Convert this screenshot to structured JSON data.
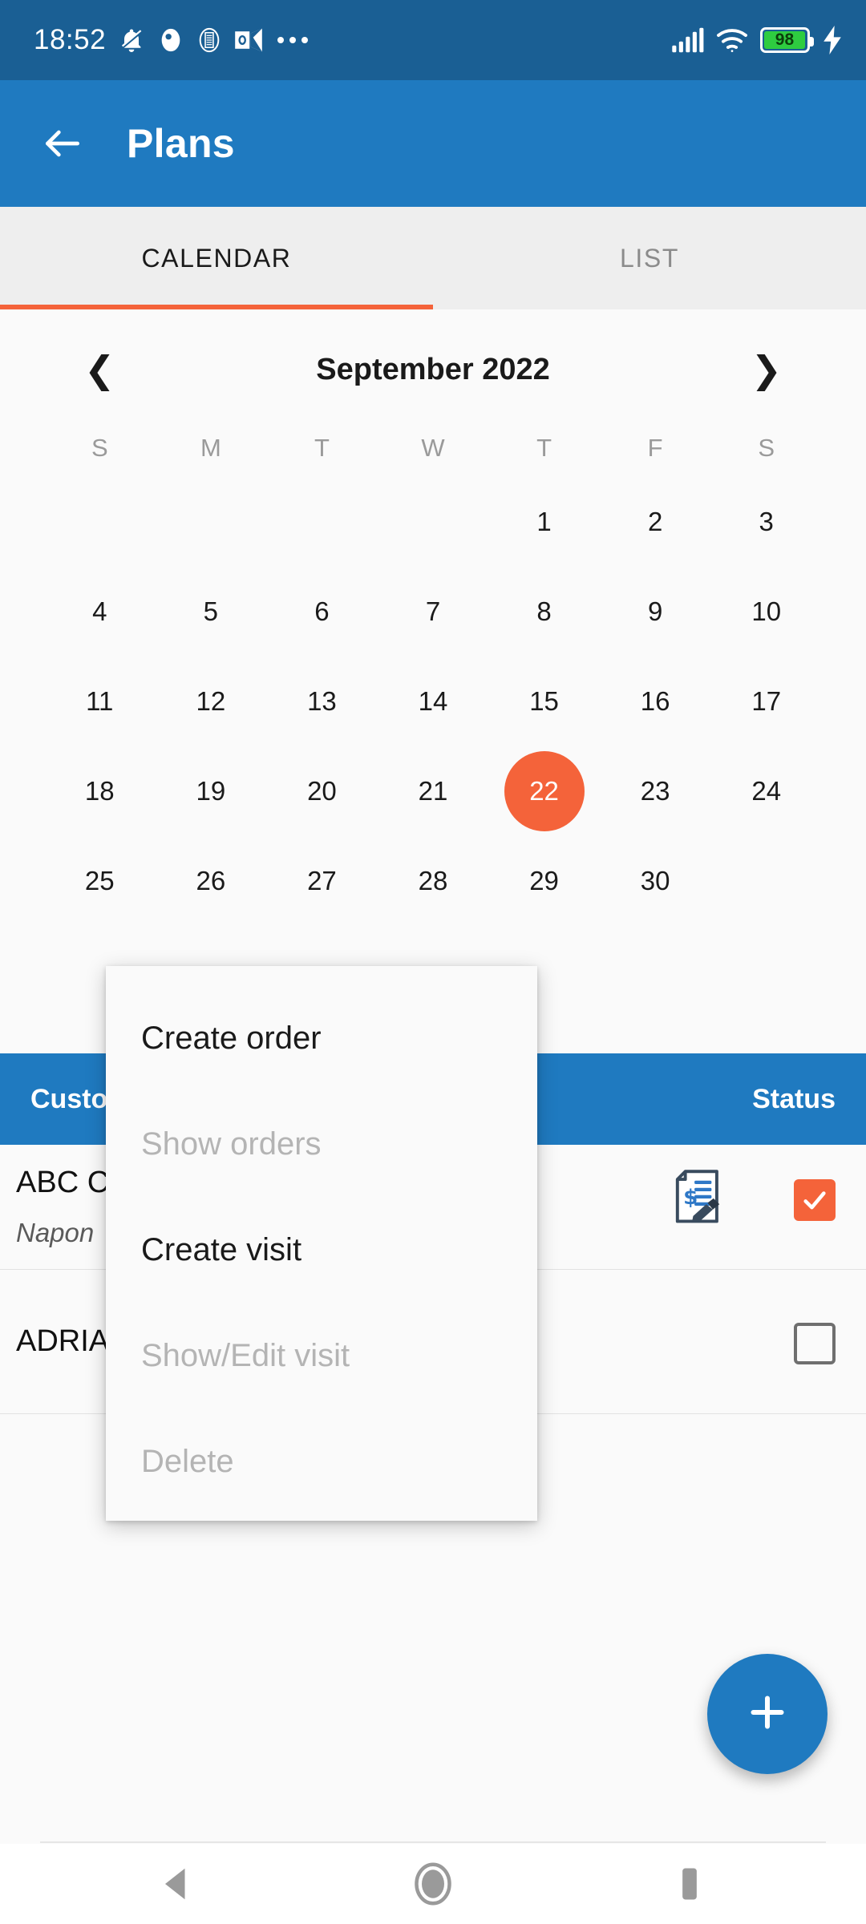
{
  "status_bar": {
    "time": "18:52",
    "battery_percent": "98",
    "icons": [
      "mute-bell-icon",
      "dot-app-icon",
      "document-app-icon",
      "outlook-icon",
      "overflow-dots-icon",
      "signal-icon",
      "wifi-icon",
      "battery-icon",
      "charging-bolt-icon"
    ],
    "colors": {
      "background": "#1a5f94",
      "battery_fill": "#2ecc40"
    }
  },
  "app_bar": {
    "title": "Plans",
    "back_icon": "back-arrow-icon",
    "background": "#1f7ac0"
  },
  "tabs": {
    "items": [
      {
        "label": "CALENDAR",
        "active": true
      },
      {
        "label": "LIST",
        "active": false
      }
    ],
    "indicator_color": "#f4633a"
  },
  "calendar": {
    "month_label": "September 2022",
    "prev_icon": "chevron-left-icon",
    "next_icon": "chevron-right-icon",
    "day_headers": [
      "S",
      "M",
      "T",
      "W",
      "T",
      "F",
      "S"
    ],
    "weeks": [
      [
        "",
        "",
        "",
        "",
        "1",
        "2",
        "3"
      ],
      [
        "4",
        "5",
        "6",
        "7",
        "8",
        "9",
        "10"
      ],
      [
        "11",
        "12",
        "13",
        "14",
        "15",
        "16",
        "17"
      ],
      [
        "18",
        "19",
        "20",
        "21",
        "22",
        "23",
        "24"
      ],
      [
        "25",
        "26",
        "27",
        "28",
        "29",
        "30",
        ""
      ]
    ],
    "selected_day": "22",
    "selected_color": "#f4633a"
  },
  "table": {
    "headers": {
      "customer": "Customer",
      "status": "Status"
    },
    "header_background": "#1f7ac0",
    "rows": [
      {
        "name": "ABC C",
        "subtitle": "Napon",
        "has_order_icon": true,
        "order_icon": "invoice-pen-icon",
        "checked": true
      },
      {
        "name": "ADRIA",
        "subtitle": "",
        "has_order_icon": false,
        "order_icon": "",
        "checked": false
      }
    ]
  },
  "context_menu": {
    "items": [
      {
        "label": "Create order",
        "disabled": false
      },
      {
        "label": "Show orders",
        "disabled": true
      },
      {
        "label": "Create visit",
        "disabled": false
      },
      {
        "label": "Show/Edit visit",
        "disabled": true
      },
      {
        "label": "Delete",
        "disabled": true
      }
    ]
  },
  "fab": {
    "icon": "plus-icon",
    "color": "#1f7ac0"
  },
  "nav_bar": {
    "buttons": [
      {
        "name": "back-triangle-icon"
      },
      {
        "name": "home-circle-icon"
      },
      {
        "name": "recents-square-icon"
      }
    ]
  }
}
